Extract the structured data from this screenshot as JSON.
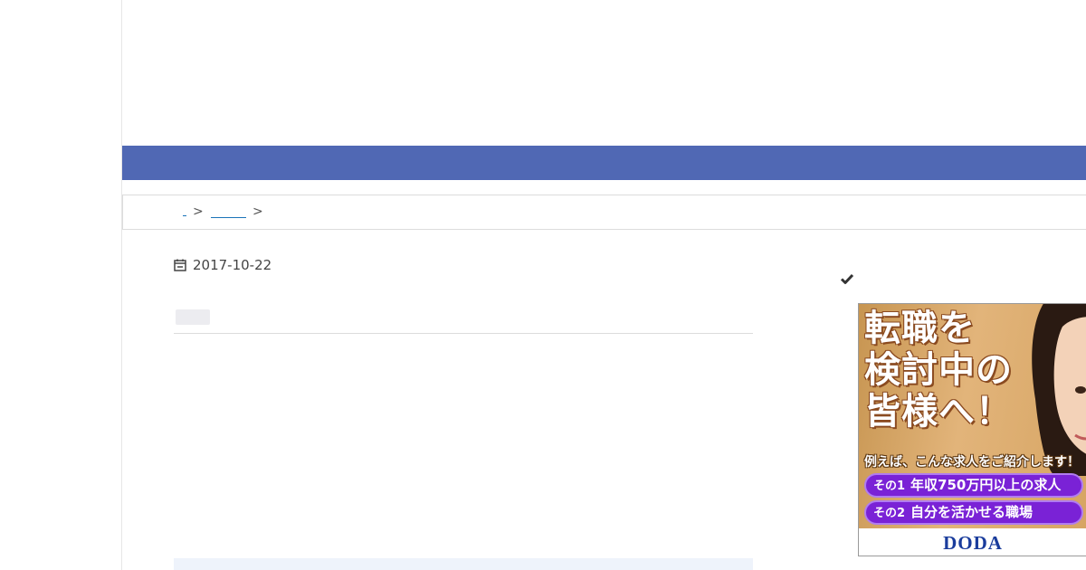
{
  "post": {
    "date": "2017-10-22"
  },
  "breadcrumb": {
    "sep1": ">",
    "sep2": ">"
  },
  "ad": {
    "headline_line1": "転職を",
    "headline_line2": "検討中の",
    "headline_line3": "皆様へ！",
    "sub": "例えば、こんな求人をご紹介します！",
    "pill1_num": "その1",
    "pill1_text": "年収750万円以上の求人",
    "pill2_num": "その2",
    "pill2_text": "自分を活かせる職場",
    "logo": "DODA"
  },
  "colors": {
    "nav": "#5068b4",
    "link": "#1a73b8",
    "ad_purple": "#7a22d6",
    "ad_logo": "#1a3c9c"
  },
  "icons": {
    "date": "calendar-icon",
    "sidebar": "check-icon"
  }
}
